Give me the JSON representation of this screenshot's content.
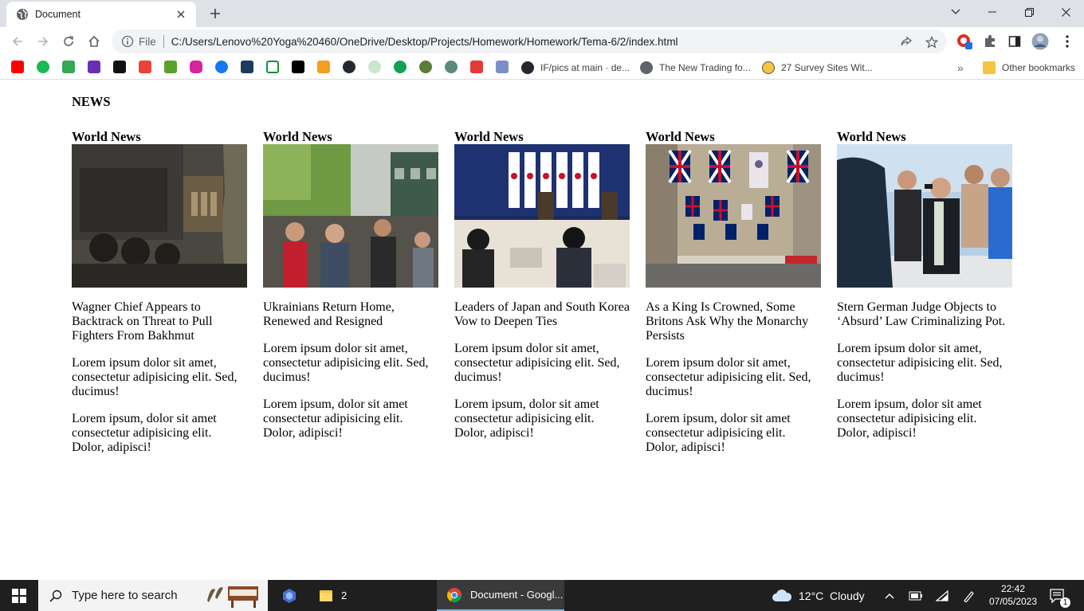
{
  "browser": {
    "tab_title": "Document",
    "address_scheme_label": "File",
    "address_url": "C:/Users/Lenovo%20Yoga%20460/OneDrive/Desktop/Projects/Homework/Homework/Tema-6/2/index.html",
    "bookmarks": [
      {
        "label": "IF/pics at main · de..."
      },
      {
        "label": "The New Trading fo..."
      },
      {
        "label": "27 Survey Sites Wit..."
      }
    ],
    "bookmarks_overflow": "»",
    "other_bookmarks": "Other bookmarks"
  },
  "page": {
    "title": "NEWS",
    "articles": [
      {
        "category": "World News",
        "headline": "Wagner Chief Appears to Backtrack on Threat to Pull Fighters From Bakhmut",
        "para1": "Lorem ipsum dolor sit amet, consectetur adipisicing elit. Sed, ducimus!",
        "para2": "Lorem ipsum, dolor sit amet consectetur adipisicing elit. Dolor, adipisci!"
      },
      {
        "category": "World News",
        "headline": "Ukrainians Return Home, Renewed and Resigned",
        "para1": "Lorem ipsum dolor sit amet, consectetur adipisicing elit. Sed, ducimus!",
        "para2": "Lorem ipsum, dolor sit amet consectetur adipisicing elit. Dolor, adipisci!"
      },
      {
        "category": "World News",
        "headline": "Leaders of Japan and South Korea Vow to Deepen Ties",
        "para1": "Lorem ipsum dolor sit amet, consectetur adipisicing elit. Sed, ducimus!",
        "para2": "Lorem ipsum, dolor sit amet consectetur adipisicing elit. Dolor, adipisci!"
      },
      {
        "category": "World News",
        "headline": "As a King Is Crowned, Some Britons Ask Why the Monarchy Persists",
        "para1": "Lorem ipsum dolor sit amet, consectetur adipisicing elit. Sed, ducimus!",
        "para2": "Lorem ipsum, dolor sit amet consectetur adipisicing elit. Dolor, adipisci!"
      },
      {
        "category": "World News",
        "headline": "Stern German Judge Objects to ‘Absurd’ Law Criminalizing Pot.",
        "para1": "Lorem ipsum dolor sit amet, consectetur adipisicing elit. Sed, ducimus!",
        "para2": "Lorem ipsum, dolor sit amet consectetur adipisicing elit. Dolor, adipisci!"
      }
    ]
  },
  "taskbar": {
    "search_placeholder": "Type here to search",
    "explorer_count": "2",
    "chrome_label": "Document - Googl...",
    "weather": "12°C  Cloudy",
    "time": "22:42",
    "date": "07/05/2023",
    "notification_count": "1"
  },
  "colors": {
    "tabstrip": "#dee1e6",
    "omnibox": "#f1f3f4",
    "taskbar": "#1f1f1f"
  }
}
